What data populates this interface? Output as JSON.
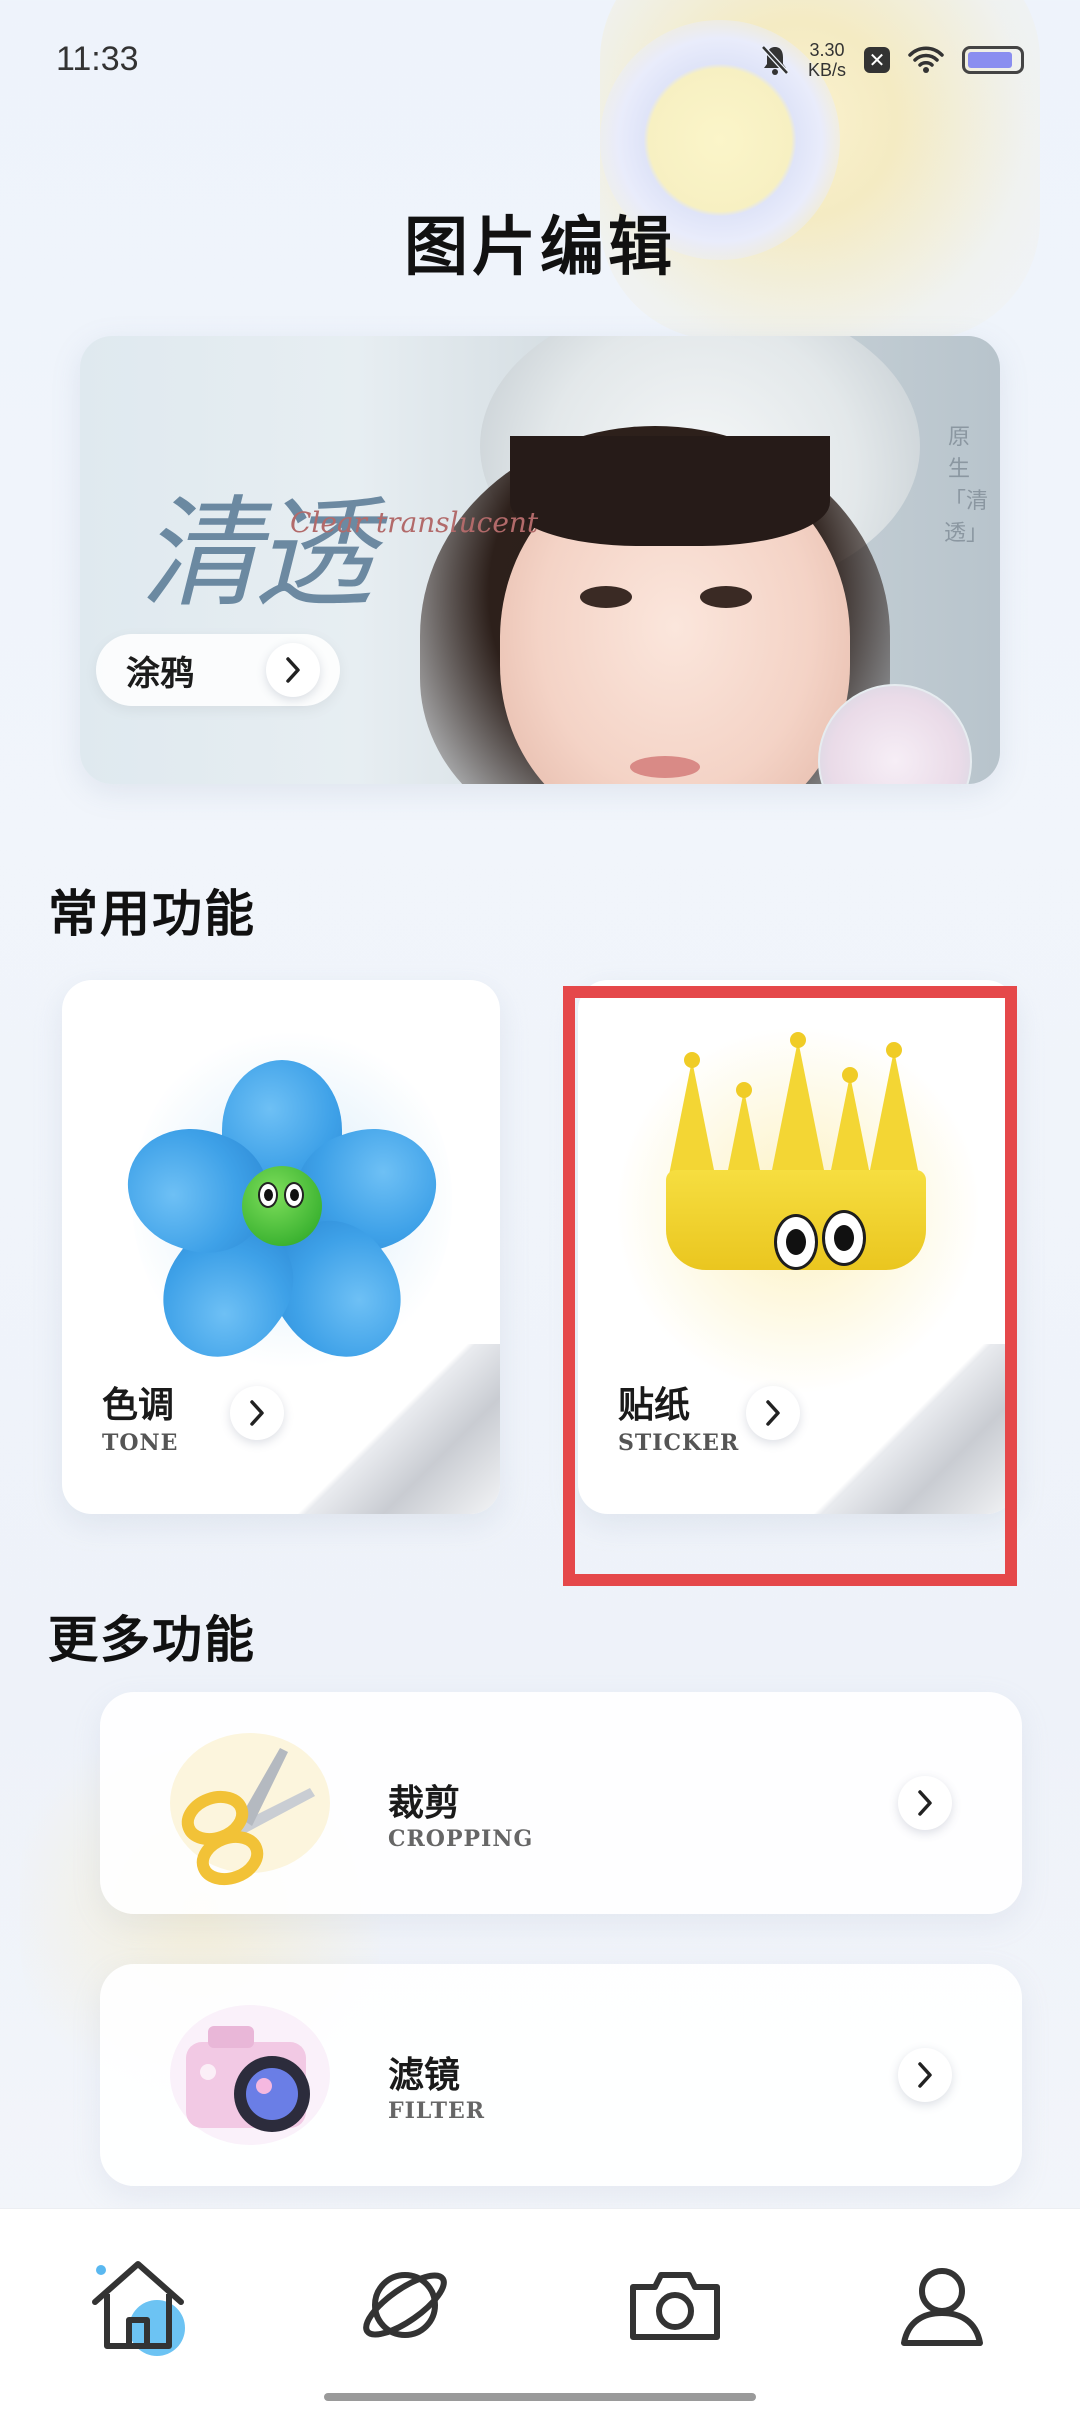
{
  "status_bar": {
    "time": "11:33",
    "speed_value": "3.30",
    "speed_unit": "KB/s"
  },
  "page": {
    "title": "图片编辑"
  },
  "banner": {
    "calligraphy": "清透",
    "script": "Clear translucent",
    "vertical_text": "原生「清透」",
    "button_label": "涂鸦"
  },
  "common_section": {
    "title": "常用功能",
    "cards": [
      {
        "label": "色调",
        "sub": "TONE",
        "icon": "flower-icon"
      },
      {
        "label": "贴纸",
        "sub": "STICKER",
        "icon": "crown-icon"
      }
    ]
  },
  "more_section": {
    "title": "更多功能",
    "items": [
      {
        "label": "裁剪",
        "sub": "CROPPING",
        "icon": "scissors-icon"
      },
      {
        "label": "滤镜",
        "sub": "FILTER",
        "icon": "camera-icon"
      }
    ]
  },
  "bottom_nav": {
    "items": [
      {
        "name": "home-icon",
        "active": true
      },
      {
        "name": "planet-icon",
        "active": false
      },
      {
        "name": "camera-icon",
        "active": false
      },
      {
        "name": "profile-icon",
        "active": false
      }
    ]
  },
  "colors": {
    "accent_blue": "#3ea1e8",
    "accent_yellow": "#f3d634",
    "highlight_red": "#e5484a"
  }
}
